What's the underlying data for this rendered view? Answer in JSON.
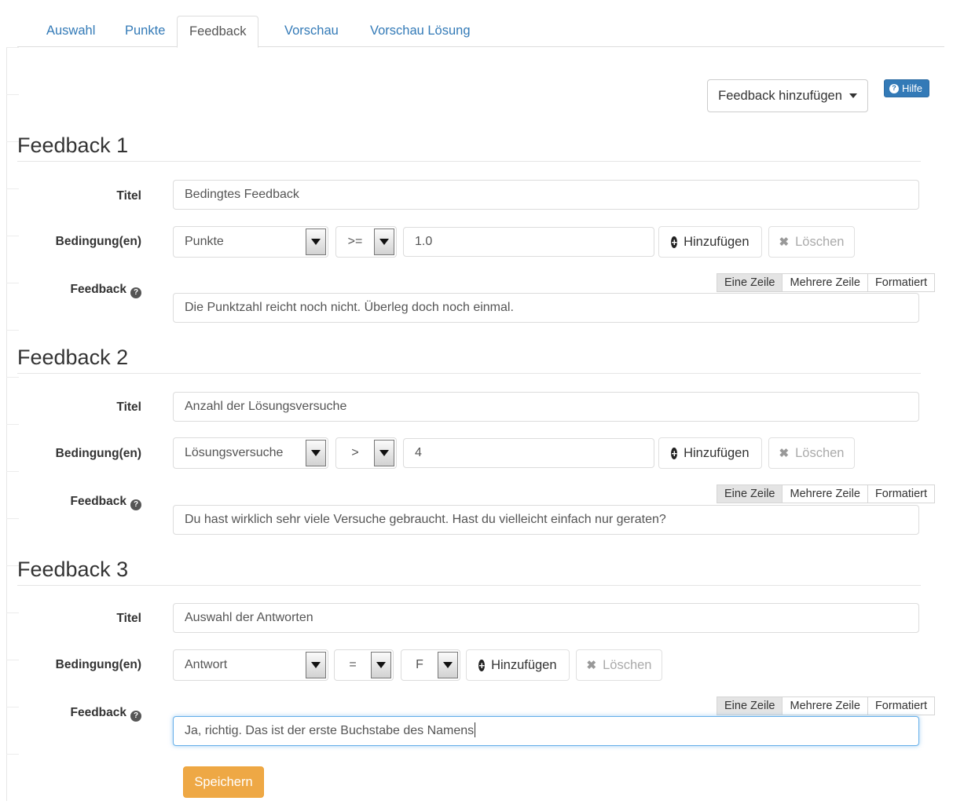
{
  "tabs": [
    {
      "label": "Auswahl",
      "active": false
    },
    {
      "label": "Punkte",
      "active": false
    },
    {
      "label": "Feedback",
      "active": true
    },
    {
      "label": "Vorschau",
      "active": false
    },
    {
      "label": "Vorschau Lösung",
      "active": false
    }
  ],
  "toolbar": {
    "add_feedback_label": "Feedback hinzufügen",
    "help_label": "Hilfe",
    "help_icon": "question-circle-icon",
    "caret_icon": "caret-down-icon"
  },
  "labels": {
    "titel": "Titel",
    "bedingungen": "Bedingung(en)",
    "feedback": "Feedback",
    "help_icon": "question-circle-icon",
    "add": "Hinzufügen",
    "delete": "Löschen",
    "add_icon": "plus-circle-icon",
    "delete_icon": "times-icon"
  },
  "editor_modes": [
    {
      "label": "Eine Zeile",
      "active": true
    },
    {
      "label": "Mehrere Zeile",
      "active": false
    },
    {
      "label": "Formatiert",
      "active": false
    }
  ],
  "sections": [
    {
      "heading": "Feedback 1",
      "titel_value": "Bedingtes Feedback",
      "condition": {
        "field": "Punkte",
        "operator": ">=",
        "value": "1.0",
        "value_is_select": false
      },
      "feedback_text": "Die Punktzahl reicht noch nicht. Überleg doch noch einmal.",
      "focused": false
    },
    {
      "heading": "Feedback 2",
      "titel_value": "Anzahl der Lösungsversuche",
      "condition": {
        "field": "Lösungsversuche",
        "operator": ">",
        "value": "4",
        "value_is_select": false
      },
      "feedback_text": "Du hast wirklich sehr viele Versuche gebraucht. Hast du vielleicht einfach nur geraten?",
      "focused": false
    },
    {
      "heading": "Feedback 3",
      "titel_value": "Auswahl der Antworten",
      "condition": {
        "field": "Antwort",
        "operator": "=",
        "value": "F",
        "value_is_select": true
      },
      "feedback_text": "Ja, richtig. Das ist der erste Buchstabe des Namens",
      "focused": true
    }
  ],
  "footer": {
    "save_label": "Speichern"
  },
  "colors": {
    "tab_link": "#337ab7",
    "help_button": "#337ab7",
    "save_button": "#eea845",
    "focus_border": "#66afe9"
  }
}
